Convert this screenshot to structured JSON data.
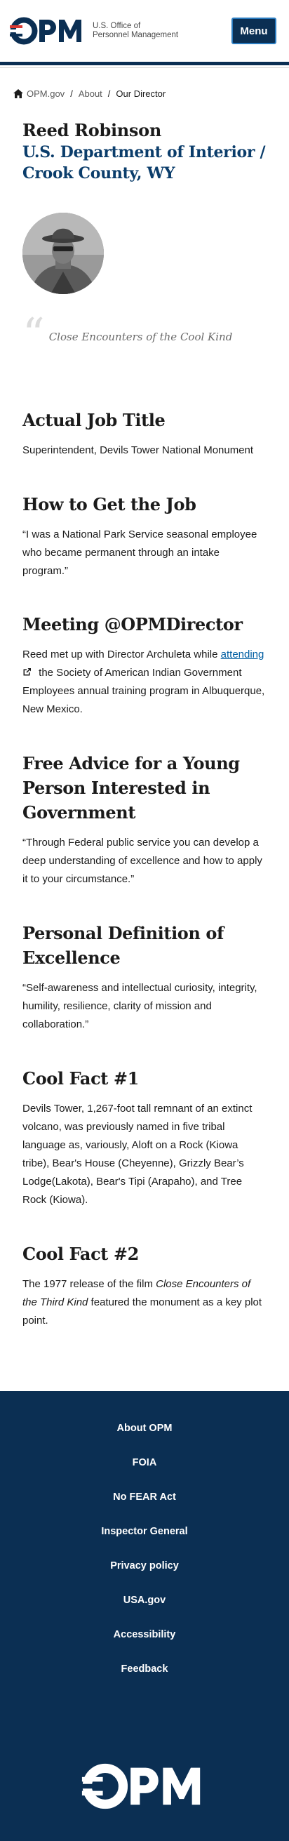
{
  "header": {
    "logo_text": "OPM",
    "logo_sub_line1": "U.S. Office of",
    "logo_sub_line2": "Personnel Management",
    "menu_label": "Menu"
  },
  "breadcrumb": {
    "home": "OPM.gov",
    "about": "About",
    "current": "Our Director"
  },
  "profile": {
    "name": "Reed Robinson",
    "org": "U.S. Department of Interior / Crook County, WY",
    "quote": "Close Encounters of the Cool Kind"
  },
  "sections": {
    "title_label": "Actual Job Title",
    "title_text": "Superintendent, Devils Tower National Monument",
    "job_label": "How to Get the Job",
    "job_text": "“I was a National Park Service seasonal employee who became permanent through an intake program.”",
    "meeting_label": "Meeting @OPMDirector",
    "meeting_before": "Reed met up with Director Archuleta while ",
    "meeting_link": "attending",
    "meeting_after": " the Society of American Indian Government Employees annual training program in Albuquerque, New Mexico.",
    "advice_label": "Free Advice for a Young Person Interested in Government",
    "advice_text": "“Through Federal public service you can develop a deep understanding of excellence and how to apply it to your circumstance.”",
    "excellence_label": "Personal Definition of Excellence",
    "excellence_text": "“Self-awareness and intellectual curiosity, integrity, humility, resilience, clarity of mission and collaboration.”",
    "fact1_label": "Cool Fact #1",
    "fact1_text": "Devils Tower, 1,267-foot tall remnant of an extinct volcano, was previously named in five tribal language as, variously, Aloft on a Rock (Kiowa tribe), Bear's House (Cheyenne), Grizzly Bear’s Lodge(Lakota), Bear's Tipi (Arapaho), and Tree Rock (Kiowa).",
    "fact2_label": "Cool Fact #2",
    "fact2_before": "The 1977 release of the film ",
    "fact2_italic": "Close Encounters of the Third Kind",
    "fact2_after": " featured the monument as a key plot point."
  },
  "footer": {
    "links": [
      "About OPM",
      "FOIA",
      "No FEAR Act",
      "Inspector General",
      "Privacy policy",
      "USA.gov",
      "Accessibility",
      "Feedback"
    ],
    "logo_text": "OPM"
  },
  "colors": {
    "navy": "#0b2f53",
    "org_blue": "#0b3d6b",
    "link_blue": "#005ea2",
    "accent_red": "#d83933"
  }
}
